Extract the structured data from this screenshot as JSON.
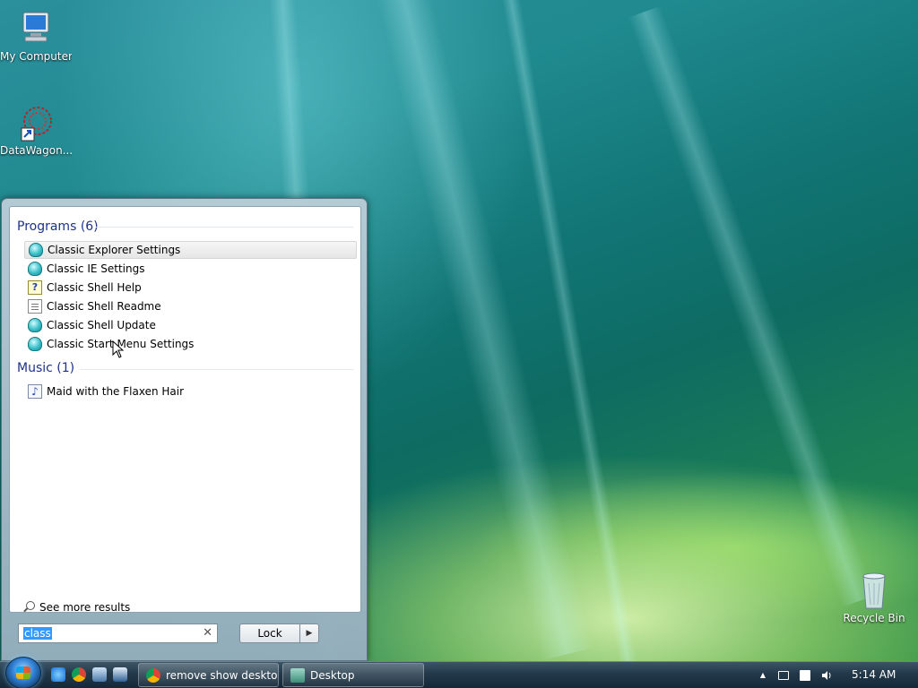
{
  "desktop": {
    "icons": [
      {
        "label": "My Computer",
        "icon": "computer-icon"
      },
      {
        "label": "DataWagon...",
        "icon": "datawagon-icon"
      },
      {
        "label": "Recycle Bin",
        "icon": "recycle-bin-icon"
      }
    ]
  },
  "start_menu": {
    "groups": [
      {
        "header": "Programs (6)",
        "items": [
          {
            "label": "Classic Explorer Settings",
            "icon": "classic-shell-icon"
          },
          {
            "label": "Classic IE Settings",
            "icon": "classic-shell-icon"
          },
          {
            "label": "Classic Shell Help",
            "icon": "help-file-icon"
          },
          {
            "label": "Classic Shell Readme",
            "icon": "text-document-icon"
          },
          {
            "label": "Classic Shell Update",
            "icon": "classic-shell-icon"
          },
          {
            "label": "Classic Start Menu Settings",
            "icon": "classic-shell-icon"
          }
        ]
      },
      {
        "header": "Music (1)",
        "items": [
          {
            "label": "Maid with the Flaxen Hair",
            "icon": "music-file-icon"
          }
        ]
      }
    ],
    "see_more": "See more results",
    "search": {
      "value": "class"
    },
    "lock_label": "Lock",
    "lock_arrow": "▶",
    "clear": "✕"
  },
  "taskbar": {
    "buttons": [
      {
        "label": "remove show deskto...",
        "icon": "chrome-icon"
      },
      {
        "label": "Desktop",
        "icon": "folder-icon"
      }
    ],
    "tray": {
      "up_arrow": "▲",
      "time": "5:14 AM"
    }
  }
}
